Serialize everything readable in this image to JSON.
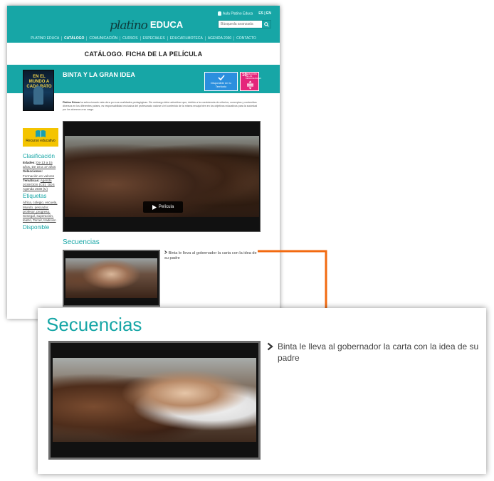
{
  "header": {
    "logo_script": "platino",
    "logo_educa": "EDUCA",
    "aula_link": "Aula Platino Educa",
    "lang_es": "ES",
    "lang_en": "EN",
    "search_placeholder": "Búsqueda avanzada",
    "nav": [
      "PLATINO EDUCA",
      "CATÁLOGO",
      "COMUNICACIÓN",
      "CURSOS",
      "ESPECIALES",
      "EDUCAFILMOTECA",
      "AGENDA 2030",
      "CONTACTO"
    ]
  },
  "page_title": "CATÁLOGO. FICHA DE LA PELÍCULA",
  "film": {
    "title": "BINTA Y LA GRAN IDEA",
    "poster_text": "EN EL MUNDO A CADA RATO",
    "badge_disponible": "Disponible en tu Territorio",
    "ods_number": "10",
    "ods_label": "REDUCCIÓN DE LAS DESIGUALDADES",
    "recurso": "Recurso educativo",
    "intro_bold": "Platino Educa",
    "intro": " ha seleccionado esta obra por sus cualidades pedagógicas. Sin embargo debe advertirse que, debido a la coexistencia de criterios, conceptos y contenidos diversos en los diferentes países, es responsabilidad exclusiva del profesorado valorar si el contenido de la misma encaja bien en los objetivos educativos para la sociedad por los alumnos a su cargo."
  },
  "sidebar": {
    "clasificacion_h": "Clasificación",
    "edades_label": "Edades:",
    "edades": "De 13 a 15 años, De 16 a 17 años",
    "selecciones_label": "Selecciones:",
    "selecciones": "Formación en valores",
    "tematicas_label": "Temáticas:",
    "tematicas": "Agenda 2030/ODS (CE), ODS Agenda 2030 (U)",
    "etiquetas_h": "Etiquetas",
    "etiquetas": "África, colegio, escuela, Mundo, pescador, profesor, progreso, Senegal, superación, teatro, Tercer, tradición",
    "disponible_h": "Disponible"
  },
  "video": {
    "play_label": "Película"
  },
  "secuencias": {
    "title": "Secuencias",
    "item": "Binta le lleva al gobernador la carta con la idea de su padre"
  },
  "colors": {
    "brand_teal": "#17a6a6",
    "arrow_orange": "#f26a10",
    "ods_pink": "#e5257b",
    "badge_blue": "#2b8fde",
    "recurso_yellow": "#f4c400"
  }
}
